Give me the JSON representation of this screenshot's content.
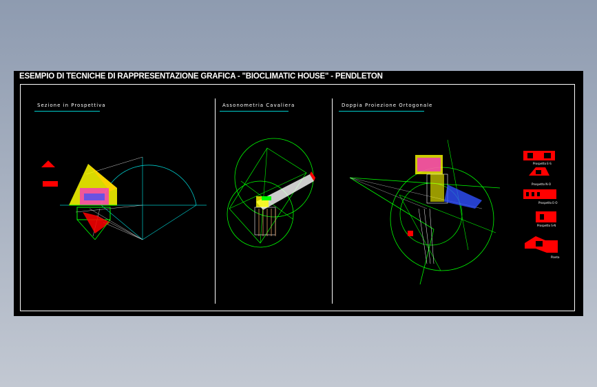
{
  "title": "ESEMPIO DI TECNICHE DI RAPPRESENTAZIONE GRAFICA - \"BIOCLIMATIC HOUSE\" - PENDLETON",
  "sections": [
    {
      "label": "Sezione in Prospettiva"
    },
    {
      "label": "Assonometria Cavaliera"
    },
    {
      "label": "Doppia Proiezione Ortogonale"
    }
  ],
  "thumbnails": [
    {
      "label": "Prospetto E-S"
    },
    {
      "label": "Prospetto N-O"
    },
    {
      "label": "Prospetto E-O"
    },
    {
      "label": "Prospetto S-N"
    },
    {
      "label": "Pianta"
    }
  ],
  "colors": {
    "sheet": "#000000",
    "rule": "#00cfd0",
    "green": "#00ff00",
    "cyan": "#00c8c8",
    "yellow": "#ffff00",
    "magenta": "#ff00ff",
    "red": "#ff0000",
    "blue": "#3050ff"
  }
}
